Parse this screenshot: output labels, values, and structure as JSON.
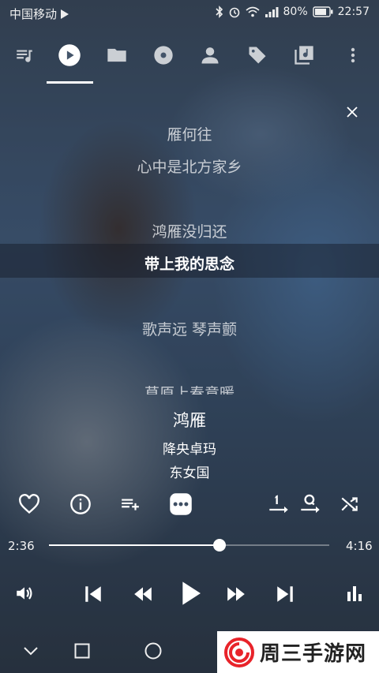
{
  "status_bar": {
    "carrier": "中国移动",
    "battery": "80%",
    "time": "22:57"
  },
  "tabs": [
    {
      "icon": "queue-music-icon"
    },
    {
      "icon": "play-circle-icon",
      "active": true
    },
    {
      "icon": "folder-icon"
    },
    {
      "icon": "album-disc-icon"
    },
    {
      "icon": "artist-person-icon"
    },
    {
      "icon": "tag-icon"
    },
    {
      "icon": "library-music-icon"
    },
    {
      "icon": "more-vert-icon"
    }
  ],
  "lyrics": {
    "lines": [
      "雁何往",
      "心中是北方家乡",
      "鸿雁没归还",
      "带上我的思念",
      "歌声远 琴声颤",
      "草原上春意暖"
    ],
    "current_index": 3
  },
  "song": {
    "title": "鸿雁",
    "artist": "降央卓玛",
    "album": "东女国"
  },
  "playback": {
    "elapsed": "2:36",
    "duration": "4:16",
    "progress_fraction": 0.609
  },
  "watermark": {
    "text": "周三手游网"
  },
  "colors": {
    "accent": "#ffffff",
    "watermark_red": "#e8232a"
  }
}
